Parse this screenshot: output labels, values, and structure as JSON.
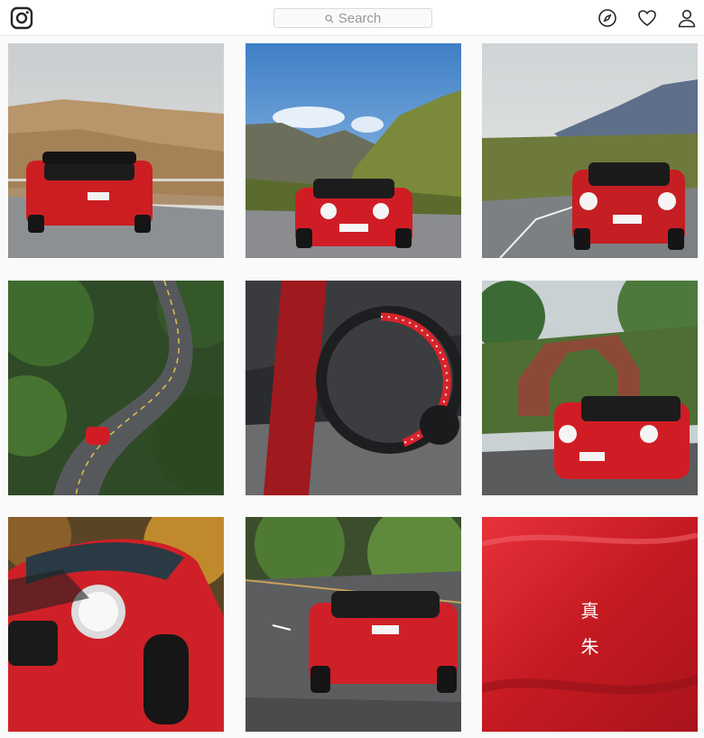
{
  "header": {
    "logo_icon": "instagram-glyph-icon",
    "search": {
      "placeholder": "Search",
      "icon": "search-icon"
    },
    "nav": [
      {
        "id": "explore",
        "icon": "compass-icon"
      },
      {
        "id": "activity",
        "icon": "heart-icon"
      },
      {
        "id": "profile",
        "icon": "person-icon"
      }
    ]
  },
  "grid": {
    "posts": [
      {
        "id": "post-1",
        "alt": "red-mini-rear-on-mountain-road"
      },
      {
        "id": "post-2",
        "alt": "red-mini-front-blue-sky-ropeway"
      },
      {
        "id": "post-3",
        "alt": "red-mini-front-curving-mountain-road"
      },
      {
        "id": "post-4",
        "alt": "red-mini-winding-forest-road-aerial"
      },
      {
        "id": "post-5",
        "alt": "mini-dashboard-gauge-closeup"
      },
      {
        "id": "post-6",
        "alt": "red-mini-stone-arch-bridge"
      },
      {
        "id": "post-7",
        "alt": "red-mini-front-headlight-autumn"
      },
      {
        "id": "post-8",
        "alt": "red-mini-rear-wet-road-forest"
      },
      {
        "id": "post-9",
        "alt": "red-paint-closeup-with-kanji",
        "caption": [
          "真",
          "朱"
        ]
      }
    ]
  },
  "colors": {
    "accent_red": "#d8232a",
    "topbar_bg": "#ffffff",
    "page_bg": "#fafafa",
    "icon": "#262626"
  }
}
